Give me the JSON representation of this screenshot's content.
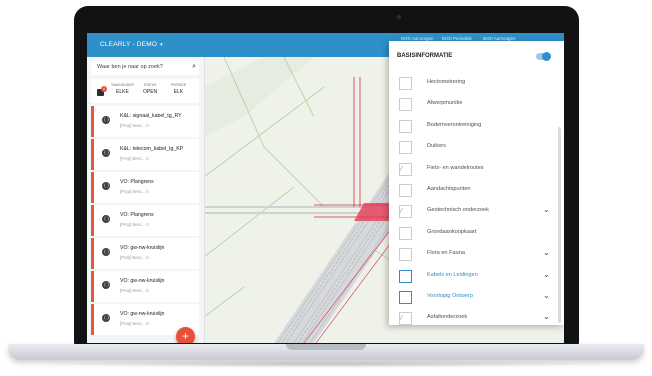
{
  "app": {
    "title": "CLEARLY - DEMO",
    "title_chevron": "▾",
    "top_tabs": [
      "BGD Aanvragen",
      "BGD Periodiek",
      "BGD Aanvragen"
    ]
  },
  "search": {
    "placeholder": "Waar ben je naar op zoek?",
    "icon": "search-icon"
  },
  "filters": {
    "badge_count": "0",
    "columns": [
      {
        "label": "TAAKHOUDER",
        "value": "ELKE"
      },
      {
        "label": "STATUS",
        "value": "OPEN"
      },
      {
        "label": "PERIODE",
        "value": "ELK"
      }
    ]
  },
  "list": {
    "items": [
      {
        "title": "K&L: signaal_kabel_tg_RY",
        "meta": "[Prop] Besc...   0"
      },
      {
        "title": "K&L: telecom_kabel_tg_KP",
        "meta": "[Prop] Besc...   0"
      },
      {
        "title": "VO: Plangrens",
        "meta": "[Prop] Besc...   0"
      },
      {
        "title": "VO: Plangrens",
        "meta": "[Prop] Besc...   0"
      },
      {
        "title": "VO: gw-nw-kruislijn",
        "meta": "[Prop] Besc...   0"
      },
      {
        "title": "VO: gw-nw-kruislijn",
        "meta": "[Prop] Besc...   0"
      },
      {
        "title": "VO: gw-nw-kruislijn",
        "meta": "[Prop] Besc...   0"
      }
    ],
    "add_label": "+"
  },
  "layers": {
    "title": "BASISINFORMATIE",
    "toggle_on": true,
    "items": [
      {
        "label": "Hectometrering",
        "checked": false,
        "expandable": false,
        "highlight": false
      },
      {
        "label": "Afwerpmunitie",
        "checked": false,
        "expandable": false,
        "highlight": false
      },
      {
        "label": "Bodemverontreiniging",
        "checked": false,
        "expandable": false,
        "highlight": false
      },
      {
        "label": "Duikers",
        "checked": false,
        "expandable": false,
        "highlight": false
      },
      {
        "label": "Fiets- en wandelroutes",
        "checked": false,
        "expandable": false,
        "highlight": false,
        "glyph": "⁄"
      },
      {
        "label": "Aandachtspunten",
        "checked": false,
        "expandable": false,
        "highlight": false
      },
      {
        "label": "Geotechnisch onderzoek",
        "checked": false,
        "expandable": true,
        "highlight": false,
        "glyph": "⁄"
      },
      {
        "label": "Grondaankoopkaart",
        "checked": false,
        "expandable": false,
        "highlight": false
      },
      {
        "label": "Flora en Fauna",
        "checked": false,
        "expandable": true,
        "highlight": false
      },
      {
        "label": "Kabels en Leidingen",
        "checked": false,
        "expandable": true,
        "highlight": true
      },
      {
        "label": "Voorlopig Ontwerp",
        "checked": false,
        "expandable": true,
        "highlight": true
      },
      {
        "label": "Asfaltonderzoek",
        "checked": false,
        "expandable": true,
        "highlight": false,
        "glyph": "⁄"
      }
    ]
  },
  "colors": {
    "accent": "#2e8fc9",
    "danger": "#e8503a",
    "road": "#b9bcc0",
    "cable": "#d0304a"
  }
}
